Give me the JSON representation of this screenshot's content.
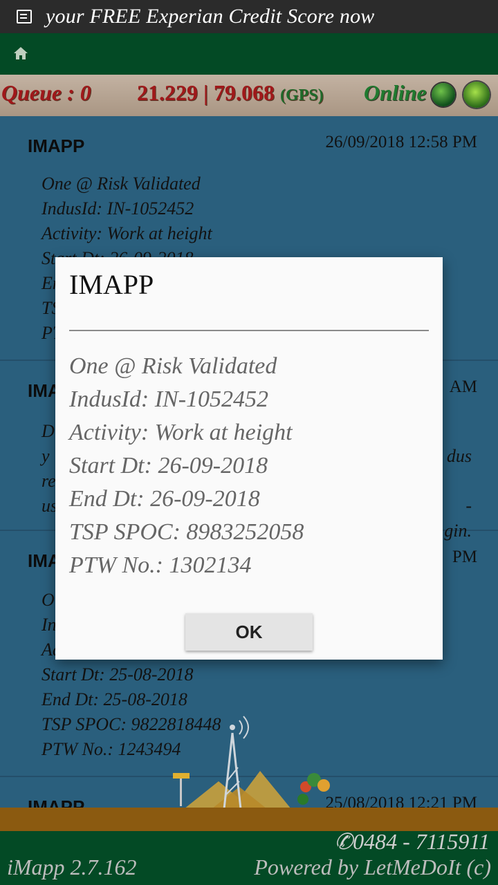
{
  "ad_banner": {
    "text": "your FREE Experian Credit Score now"
  },
  "status": {
    "queue": "Queue : 0",
    "gps_coords": "21.229 | 79.068",
    "gps_tag": "(GPS)",
    "online": "Online"
  },
  "list": [
    {
      "title": "IMAPP",
      "time": "26/09/2018 12:58 PM",
      "lines": [
        "One @ Risk Validated",
        "IndusId: IN-1052452",
        "Activity: Work at height",
        "Start Dt: 26-09-2018",
        "En",
        "TS",
        "PT"
      ]
    },
    {
      "title": "IMA",
      "time": "AM",
      "lines": [
        "D",
        "y",
        "re",
        "us"
      ],
      "right_lines": [
        "dus",
        "",
        "-",
        "gin."
      ]
    },
    {
      "title": "IMA",
      "time": "PM",
      "lines": [
        "O",
        "In",
        "Ad",
        "Start Dt: 25-08-2018",
        "End Dt: 25-08-2018",
        "TSP SPOC: 9822818448",
        "PTW No.: 1243494"
      ]
    },
    {
      "title": "IMAPP",
      "time": "25/08/2018 12:21 PM",
      "lines": []
    }
  ],
  "footer": {
    "version": "iMapp 2.7.162",
    "phone": "0484 - 7115911",
    "powered": "Powered by LetMeDoIt (c)"
  },
  "dialog": {
    "title": "IMAPP",
    "lines": [
      "One @ Risk Validated",
      "IndusId: IN-1052452",
      "Activity: Work at height",
      "Start Dt: 26-09-2018",
      "End Dt: 26-09-2018",
      "TSP SPOC: 8983252058",
      "PTW No.: 1302134"
    ],
    "ok_label": "OK"
  }
}
